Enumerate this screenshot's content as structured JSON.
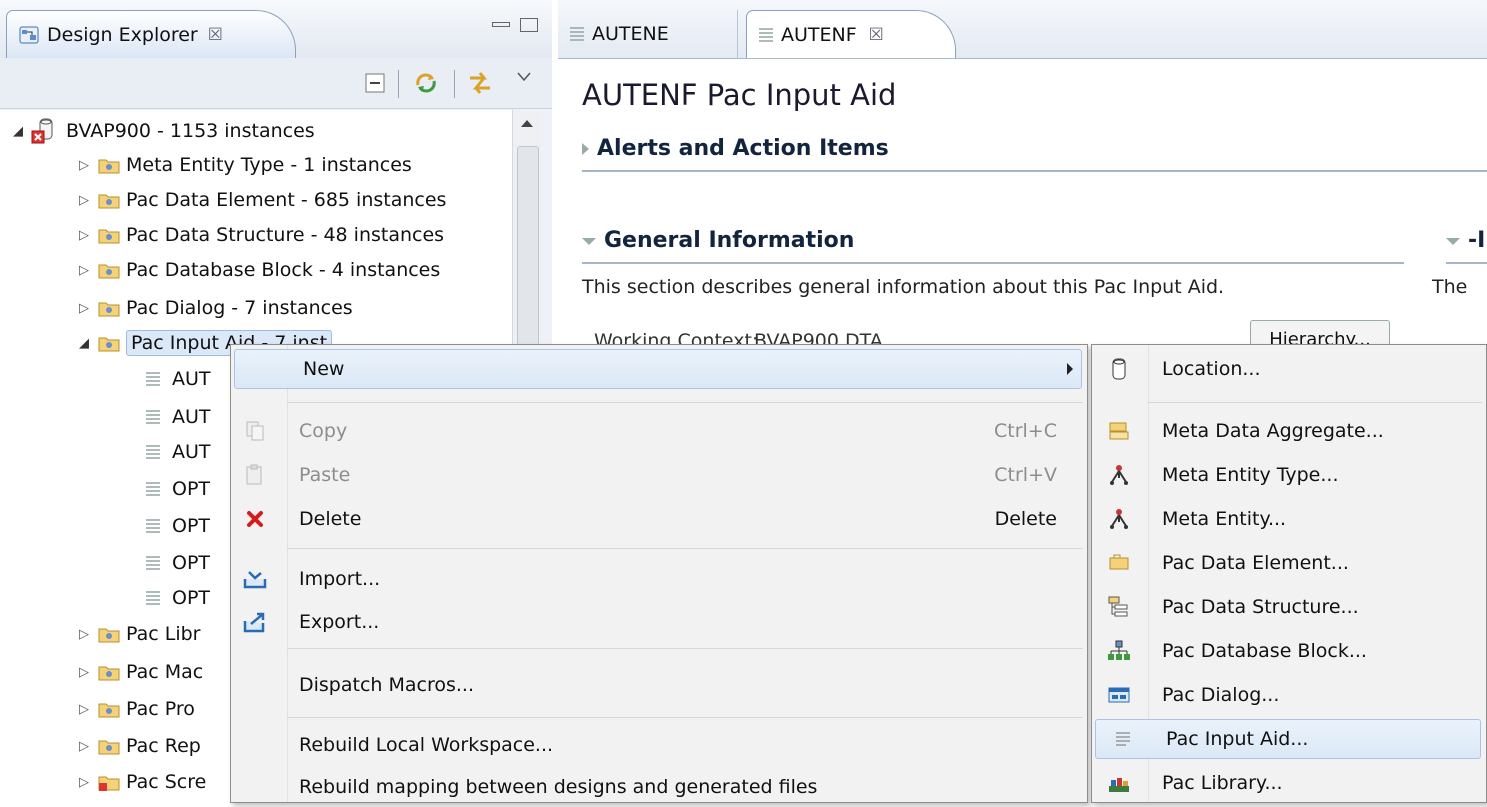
{
  "explorer": {
    "tab_title": "Design Explorer",
    "tab_close": "☒",
    "tree": [
      {
        "label": "BVAP900 - 1153 instances",
        "level": 0,
        "expanded": true
      },
      {
        "label": "Meta Entity Type - 1 instances",
        "level": 1
      },
      {
        "label": "Pac Data Element - 685 instances",
        "level": 1
      },
      {
        "label": "Pac Data Structure - 48 instances",
        "level": 1
      },
      {
        "label": "Pac Database Block - 4 instances",
        "level": 1
      },
      {
        "label": "Pac Dialog - 7 instances",
        "level": 1
      },
      {
        "label": "Pac Input Aid - 7 inst",
        "level": 1,
        "expanded": true,
        "selected": true
      },
      {
        "label": "AUT",
        "level": 2
      },
      {
        "label": "AUT",
        "level": 2
      },
      {
        "label": "AUT",
        "level": 2
      },
      {
        "label": "OPT",
        "level": 2
      },
      {
        "label": "OPT",
        "level": 2
      },
      {
        "label": "OPT",
        "level": 2
      },
      {
        "label": "OPT",
        "level": 2
      },
      {
        "label": "Pac Libr",
        "level": 1
      },
      {
        "label": "Pac Mac",
        "level": 1
      },
      {
        "label": "Pac Pro",
        "level": 1
      },
      {
        "label": "Pac Rep",
        "level": 1
      },
      {
        "label": "Pac Scre",
        "level": 1
      }
    ]
  },
  "editor": {
    "tabs": [
      {
        "label": "AUTENE"
      },
      {
        "label": "AUTENF",
        "close": "☒"
      }
    ],
    "title": "AUTENF Pac Input Aid",
    "alerts_section": "Alerts and Action Items",
    "general_section": "General Information",
    "general_desc": "This section describes general information about this Pac Input Aid.",
    "partial_right_header": "-I",
    "partial_right_desc": "The",
    "working_context_label": "Working Context:",
    "working_context_value": "BVAP900 DTA",
    "hierarchy_button": "Hierarchy..."
  },
  "context_menu": {
    "items": [
      {
        "label": "New",
        "shortcut": "",
        "disabled": false,
        "icon": "",
        "submenu": true
      },
      {
        "label": "Copy",
        "shortcut": "Ctrl+C",
        "disabled": true,
        "icon": "copy-icon"
      },
      {
        "label": "Paste",
        "shortcut": "Ctrl+V",
        "disabled": true,
        "icon": "paste-icon"
      },
      {
        "label": "Delete",
        "shortcut": "Delete",
        "disabled": false,
        "icon": "delete-icon"
      },
      {
        "label": "Import...",
        "shortcut": "",
        "disabled": false,
        "icon": "import-icon"
      },
      {
        "label": "Export...",
        "shortcut": "",
        "disabled": false,
        "icon": "export-icon"
      },
      {
        "label": "Dispatch Macros...",
        "shortcut": "",
        "disabled": false,
        "icon": ""
      },
      {
        "label": "Rebuild Local Workspace...",
        "shortcut": "",
        "disabled": false,
        "icon": ""
      },
      {
        "label": "Rebuild mapping between designs and generated files",
        "shortcut": "",
        "disabled": false,
        "icon": ""
      }
    ]
  },
  "submenu": {
    "items": [
      {
        "label": "Location...",
        "icon": "location-icon"
      },
      {
        "label": "Meta Data Aggregate...",
        "icon": "meta-data-aggregate-icon"
      },
      {
        "label": "Meta Entity Type...",
        "icon": "meta-entity-type-icon"
      },
      {
        "label": "Meta Entity...",
        "icon": "meta-entity-icon"
      },
      {
        "label": "Pac Data Element...",
        "icon": "pac-data-element-icon"
      },
      {
        "label": "Pac Data Structure...",
        "icon": "pac-data-structure-icon"
      },
      {
        "label": "Pac Database Block...",
        "icon": "pac-database-block-icon"
      },
      {
        "label": "Pac Dialog...",
        "icon": "pac-dialog-icon"
      },
      {
        "label": "Pac Input Aid...",
        "icon": "pac-input-aid-icon"
      },
      {
        "label": "Pac Library...",
        "icon": "pac-library-icon"
      }
    ]
  },
  "colors": {
    "menu_bg": "#f2f2f2",
    "hover_bg": "#dbe8f6",
    "delete_red": "#d41c1c"
  }
}
